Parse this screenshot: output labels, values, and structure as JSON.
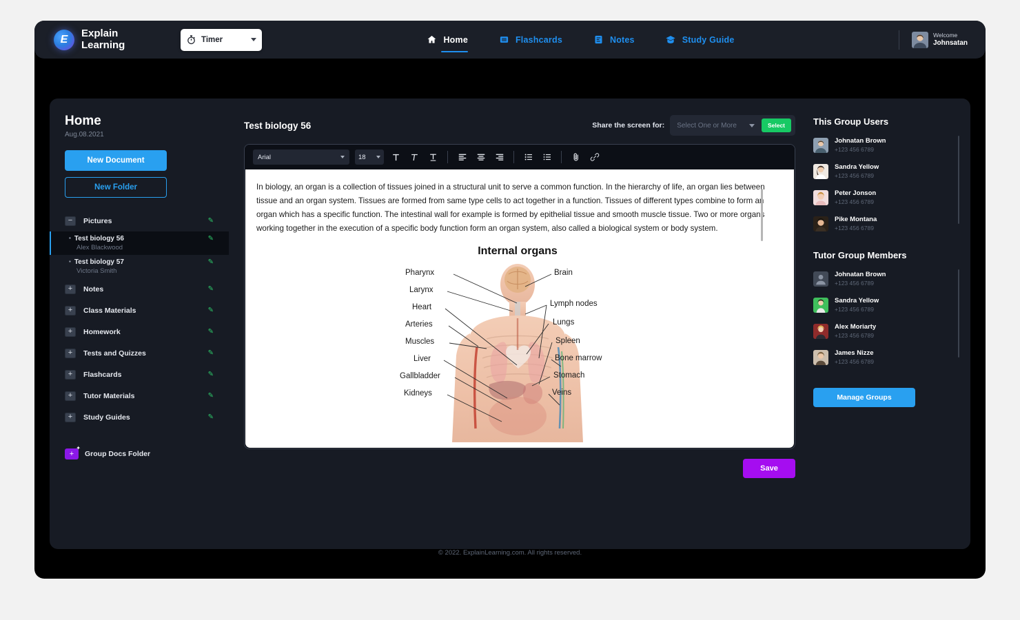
{
  "brand": {
    "name_line1": "Explain",
    "name_line2": "Learning",
    "logo_glyph": "E"
  },
  "timer": {
    "label": "Timer",
    "icon": "stopwatch-icon"
  },
  "nav": [
    {
      "label": "Home",
      "icon": "home-icon",
      "active": true
    },
    {
      "label": "Flashcards",
      "icon": "flashcards-icon",
      "active": false
    },
    {
      "label": "Notes",
      "icon": "notes-icon",
      "active": false
    },
    {
      "label": "Study Guide",
      "icon": "study-guide-icon",
      "active": false
    }
  ],
  "user": {
    "welcome": "Welcome",
    "name": "Johnsatan"
  },
  "sidebar": {
    "title": "Home",
    "date": "Aug.08.2021",
    "new_document": "New Document",
    "new_folder": "New Folder",
    "folders": [
      {
        "name": "Pictures",
        "icon": "folder-minus-icon"
      },
      {
        "name": "Notes",
        "icon": "folder-plus-icon"
      },
      {
        "name": "Class Materials",
        "icon": "folder-plus-icon"
      },
      {
        "name": "Homework",
        "icon": "folder-plus-icon"
      },
      {
        "name": "Tests and Quizzes",
        "icon": "folder-plus-icon"
      },
      {
        "name": "Flashcards",
        "icon": "folder-plus-icon"
      },
      {
        "name": "Tutor Materials",
        "icon": "folder-plus-icon"
      },
      {
        "name": "Study Guides",
        "icon": "folder-plus-icon"
      }
    ],
    "documents": [
      {
        "name": "Test biology 56",
        "author": "Alex Blackwood",
        "selected": true
      },
      {
        "name": "Test biology 57",
        "author": "Victoria Smith",
        "selected": false
      }
    ],
    "group_docs_folder": "Group Docs Folder"
  },
  "content": {
    "doc_title": "Test biology 56",
    "share_label": "Share the screen for:",
    "share_placeholder": "Select One or More",
    "select_button": "Select",
    "save_button": "Save",
    "toolbar": {
      "font": "Arial",
      "size": "18",
      "buttons": [
        "bold-icon",
        "italic-icon",
        "underline-icon",
        "align-left-icon",
        "align-center-icon",
        "align-right-icon",
        "bullet-list-icon",
        "numbered-list-icon",
        "attachment-icon",
        "link-icon"
      ]
    },
    "paragraph": "In biology, an organ is a collection of tissues joined in a structural unit to serve a common function. In the hierarchy of life, an organ lies between tissue and an organ system. Tissues are formed from same type cells to act together in a function. Tissues of different types combine to form an organ which has a specific function. The intestinal wall for example is formed by epithelial tissue and smooth muscle tissue. Two or more organs working together in the execution of a specific body function form an organ system, also called a biological system or body system.",
    "figure": {
      "title": "Internal organs",
      "left_labels": [
        "Pharynx",
        "Larynx",
        "Heart",
        "Arteries",
        "Muscles",
        "Liver",
        "Gallbladder",
        "Kidneys"
      ],
      "right_labels": [
        "Brain",
        "Lymph nodes",
        "Lungs",
        "Spleen",
        "Bone marrow",
        "Stomach",
        "Veins"
      ]
    }
  },
  "right": {
    "group_users_title": "This Group Users",
    "group_users": [
      {
        "name": "Johnatan Brown",
        "phone": "+123 456 6789"
      },
      {
        "name": "Sandra Yellow",
        "phone": "+123 456 6789"
      },
      {
        "name": "Peter Jonson",
        "phone": "+123 456 6789"
      },
      {
        "name": "Pike Montana",
        "phone": "+123 456 6789"
      }
    ],
    "tutor_title": "Tutor Group Members",
    "tutor_members": [
      {
        "name": "Johnatan Brown",
        "phone": "+123 456 6789"
      },
      {
        "name": "Sandra Yellow",
        "phone": "+123 456 6789"
      },
      {
        "name": "Alex Moriarty",
        "phone": "+123 456 6789"
      },
      {
        "name": "James Nizze",
        "phone": "+123 456 6789"
      }
    ],
    "manage_groups": "Manage Groups"
  },
  "footer": {
    "text": "© 2022. ExplainLearning.com. All rights reserved."
  },
  "colors": {
    "accent_blue": "#29a0f0",
    "accent_green": "#17c964",
    "accent_purple": "#a50df0",
    "panel_bg": "#171b24",
    "page_bg": "#000000"
  }
}
